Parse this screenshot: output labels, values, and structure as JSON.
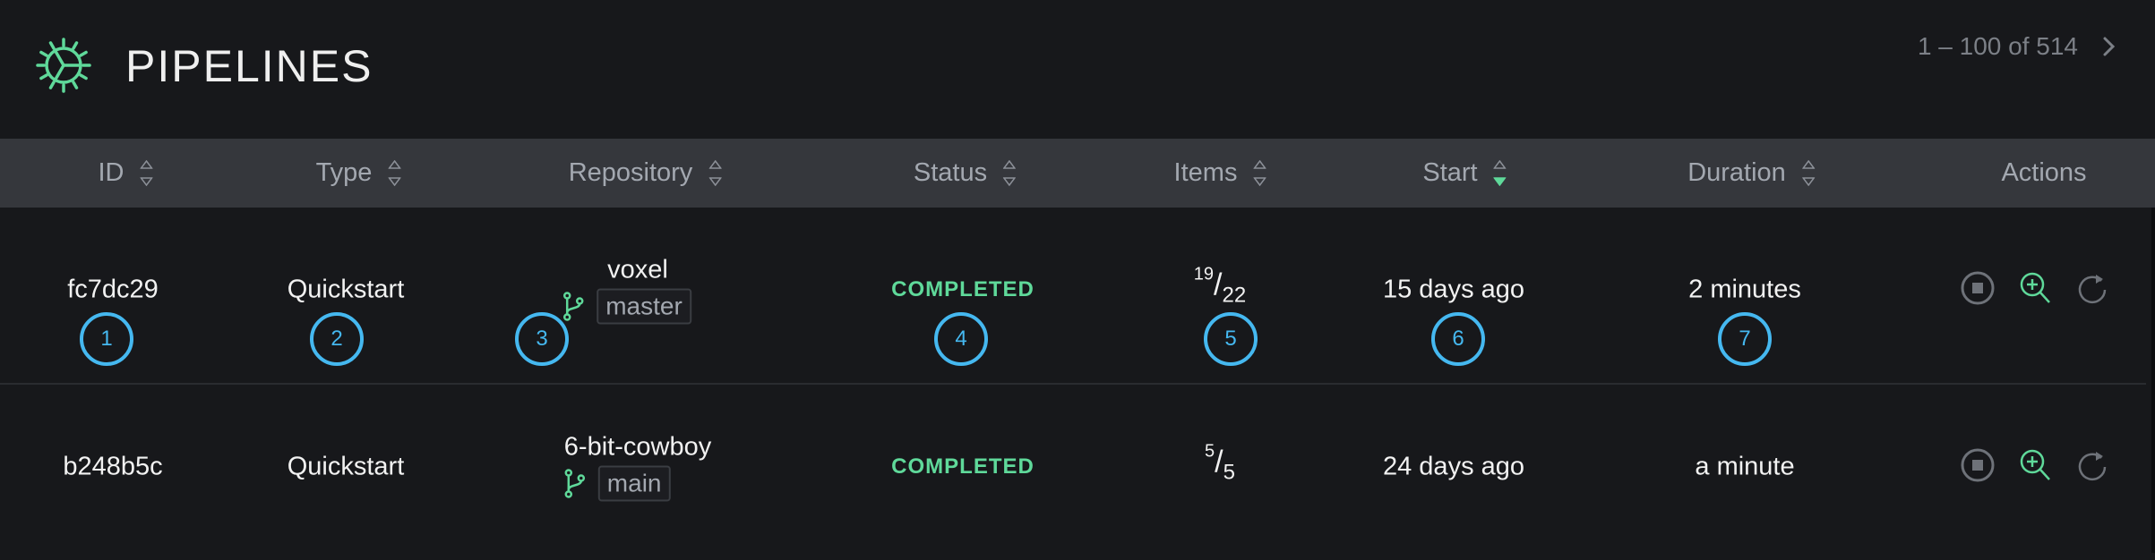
{
  "header": {
    "title": "PIPELINES",
    "pagination": "1 – 100 of 514",
    "next_icon": "chevron-right-icon",
    "logo_icon": "gear-wheel-icon"
  },
  "columns": [
    {
      "key": "id",
      "label": "ID",
      "sortable": true,
      "sort": "none"
    },
    {
      "key": "type",
      "label": "Type",
      "sortable": true,
      "sort": "none"
    },
    {
      "key": "repository",
      "label": "Repository",
      "sortable": true,
      "sort": "none"
    },
    {
      "key": "status",
      "label": "Status",
      "sortable": true,
      "sort": "none"
    },
    {
      "key": "items",
      "label": "Items",
      "sortable": true,
      "sort": "none"
    },
    {
      "key": "start",
      "label": "Start",
      "sortable": true,
      "sort": "descending"
    },
    {
      "key": "duration",
      "label": "Duration",
      "sortable": true,
      "sort": "none"
    },
    {
      "key": "actions",
      "label": "Actions",
      "sortable": false
    }
  ],
  "rows": [
    {
      "id": "fc7dc29",
      "type": "Quickstart",
      "repo": "voxel",
      "branch": "master",
      "status": "COMPLETED",
      "items_done": "19",
      "items_total": "22",
      "start": "15 days ago",
      "duration": "2 minutes",
      "actions": [
        "stop-icon",
        "inspect-zoom-icon",
        "restart-icon"
      ]
    },
    {
      "id": "b248b5c",
      "type": "Quickstart",
      "repo": "6-bit-cowboy",
      "branch": "main",
      "status": "COMPLETED",
      "items_done": "5",
      "items_total": "5",
      "start": "24 days ago",
      "duration": "a minute",
      "actions": [
        "stop-icon",
        "inspect-zoom-icon",
        "restart-icon"
      ]
    }
  ],
  "markers": [
    "1",
    "2",
    "3",
    "4",
    "5",
    "6",
    "7"
  ],
  "colors": {
    "accent": "#5fd99a",
    "marker": "#45b8f0",
    "header_bg": "#35373c",
    "page_bg": "#17181b"
  }
}
